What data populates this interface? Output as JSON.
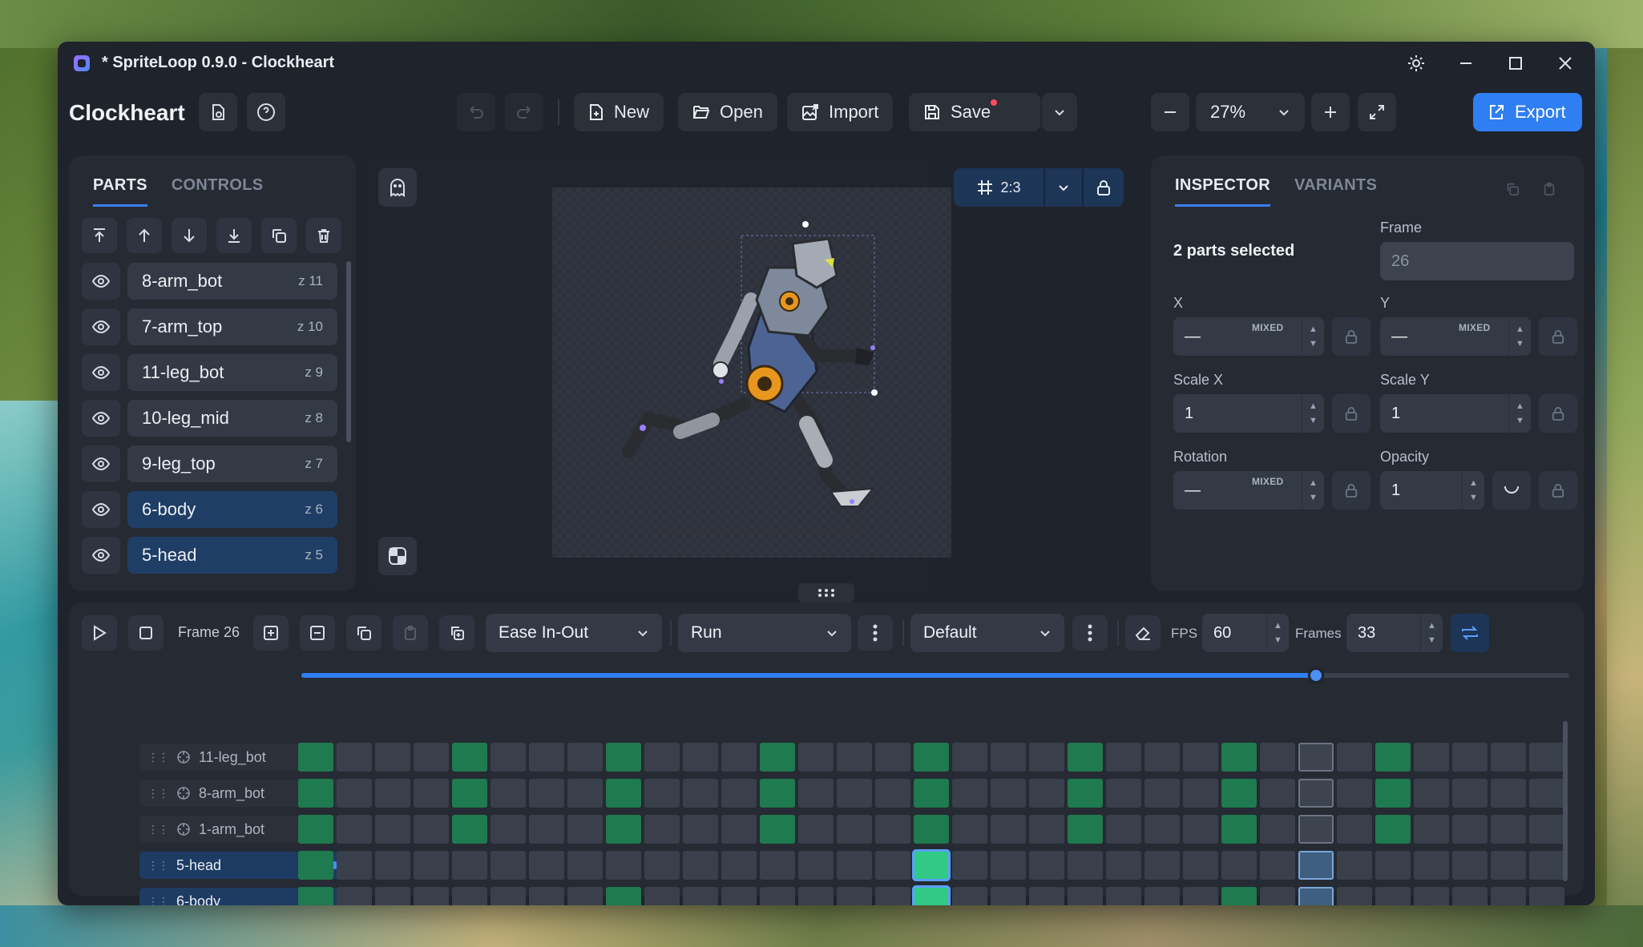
{
  "window": {
    "title": "* SpriteLoop 0.9.0 - Clockheart"
  },
  "toolbar": {
    "doc_title": "Clockheart",
    "new_label": "New",
    "open_label": "Open",
    "import_label": "Import",
    "save_label": "Save",
    "zoom_value": "27%",
    "export_label": "Export"
  },
  "parts_panel": {
    "tabs": [
      "PARTS",
      "CONTROLS"
    ],
    "items": [
      {
        "name": "8-arm_bot",
        "z": "z 11",
        "selected": false
      },
      {
        "name": "7-arm_top",
        "z": "z 10",
        "selected": false
      },
      {
        "name": "11-leg_bot",
        "z": "z 9",
        "selected": false
      },
      {
        "name": "10-leg_mid",
        "z": "z 8",
        "selected": false
      },
      {
        "name": "9-leg_top",
        "z": "z 7",
        "selected": false
      },
      {
        "name": "6-body",
        "z": "z 6",
        "selected": true
      },
      {
        "name": "5-head",
        "z": "z 5",
        "selected": true
      }
    ]
  },
  "canvas": {
    "aspect_ratio": "2:3"
  },
  "inspector": {
    "tabs": [
      "INSPECTOR",
      "VARIANTS"
    ],
    "selection_text": "2 parts selected",
    "frame_label": "Frame",
    "frame_value": "26",
    "x_label": "X",
    "y_label": "Y",
    "mixed_text": "MIXED",
    "dash": "—",
    "scale_x_label": "Scale X",
    "scale_x_value": "1",
    "scale_y_label": "Scale Y",
    "scale_y_value": "1",
    "rotation_label": "Rotation",
    "opacity_label": "Opacity",
    "opacity_value": "1"
  },
  "timeline": {
    "frame_label": "Frame 26",
    "easing": "Ease In-Out",
    "animation": "Run",
    "variant": "Default",
    "fps_label": "FPS",
    "fps_value": "60",
    "frames_label": "Frames",
    "frames_value": "33",
    "playhead_progress": 0.8,
    "tracks": [
      {
        "name": "11-leg_bot",
        "selected": false,
        "keys": [
          0,
          4,
          8,
          12,
          16,
          20,
          24,
          28
        ]
      },
      {
        "name": "8-arm_bot",
        "selected": false,
        "keys": [
          0,
          4,
          8,
          12,
          16,
          20,
          24,
          28
        ]
      },
      {
        "name": "1-arm_bot",
        "selected": false,
        "keys": [
          0,
          4,
          8,
          12,
          16,
          20,
          24,
          28
        ]
      },
      {
        "name": "5-head",
        "selected": true,
        "keys": [
          0,
          16
        ]
      },
      {
        "name": "6-body",
        "selected": true,
        "keys": [
          0,
          8,
          16,
          24
        ]
      }
    ],
    "current_frame_index": 16,
    "ghost_frame_index": 26
  },
  "colors": {
    "accent": "#2f7ef2",
    "keyframe": "#1f7a4f",
    "selected_row": "#1f3e66"
  }
}
